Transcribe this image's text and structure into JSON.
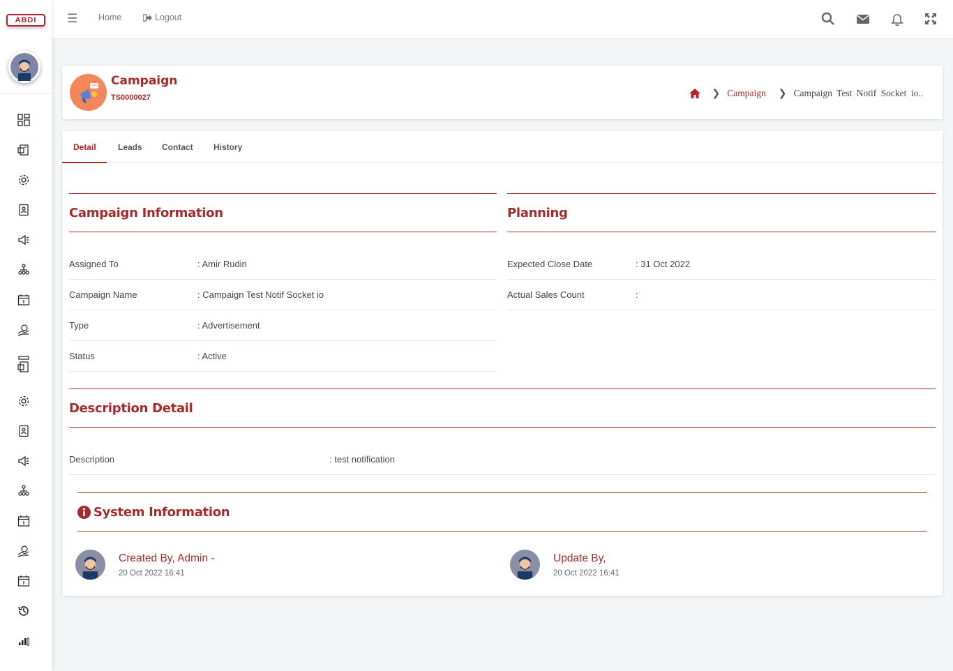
{
  "sidebar": {
    "logo_text": "ABDI",
    "icons": [
      "dashboard-icon",
      "document-icon",
      "gear-icon",
      "contact-book-icon",
      "megaphone-icon",
      "org-chart-icon",
      "calendar-icon",
      "handshake-icon",
      "document-calendar-icon",
      "gear-icon",
      "contact-book-icon",
      "megaphone-icon",
      "org-chart-icon",
      "calendar-icon",
      "handshake-icon",
      "calendar-icon",
      "history-icon",
      "bar-chart-icon"
    ]
  },
  "topbar": {
    "home_label": "Home",
    "logout_label": "Logout",
    "icons": [
      "search-icon",
      "mail-icon",
      "bell-icon",
      "fullscreen-icon"
    ]
  },
  "header": {
    "title": "Campaign",
    "code": "TS0000027",
    "breadcrumb": {
      "link": "Campaign",
      "current": "Campaign Test Notif Socket io.."
    }
  },
  "tabs": [
    "Detail",
    "Leads",
    "Contact",
    "History"
  ],
  "campaign_info": {
    "title": "Campaign Information",
    "rows": [
      {
        "label": "Assigned To",
        "value": ": Amir Rudin"
      },
      {
        "label": "Campaign Name",
        "value": ": Campaign Test Notif Socket io"
      },
      {
        "label": "Type",
        "value": ": Advertisement"
      },
      {
        "label": "Status",
        "value": ": Active"
      }
    ]
  },
  "planning": {
    "title": "Planning",
    "rows": [
      {
        "label": "Expected Close Date",
        "value": ": 31 Oct 2022"
      },
      {
        "label": "Actual Sales Count",
        "value": ":"
      }
    ]
  },
  "description": {
    "title": "Description Detail",
    "label": "Description",
    "value": ": test notification"
  },
  "system": {
    "title": "System Information",
    "created_by": "Created By, Admin -",
    "created_date": "20 Oct 2022 16:41",
    "updated_by": "Update By,",
    "updated_date": "20 Oct 2022 16:41"
  },
  "colors": {
    "accent": "#a52a2a",
    "brand": "#b5222a",
    "logo_bg": "#f3875b"
  }
}
